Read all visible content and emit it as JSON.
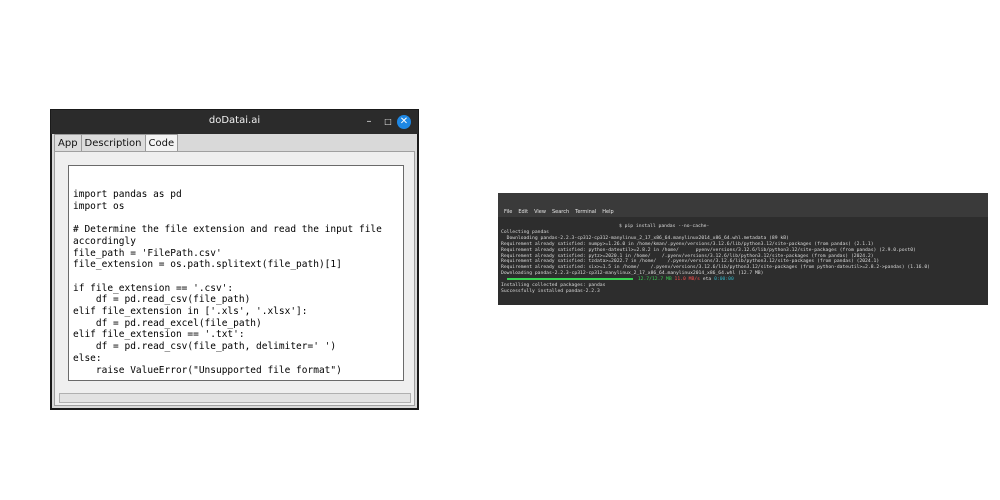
{
  "app_window": {
    "title": "doDatai.ai",
    "controls": {
      "minimize": "–",
      "maximize": "□",
      "close": "✕"
    },
    "tabs": [
      {
        "label": "App",
        "active": false
      },
      {
        "label": "Description",
        "active": false
      },
      {
        "label": "Code",
        "active": true
      }
    ],
    "code": "import pandas as pd\nimport os\n\n# Determine the file extension and read the input file\naccordingly\nfile_path = 'FilePath.csv'\nfile_extension = os.path.splitext(file_path)[1]\n\nif file_extension == '.csv':\n    df = pd.read_csv(file_path)\nelif file_extension in ['.xls', '.xlsx']:\n    df = pd.read_excel(file_path)\nelif file_extension == '.txt':\n    df = pd.read_csv(file_path, delimiter=' ')\nelse:\n    raise ValueError(\"Unsupported file format\")"
  },
  "terminal": {
    "menu": [
      "File",
      "Edit",
      "View",
      "Search",
      "Terminal",
      "Help"
    ],
    "command": "$ pip install pandas --no-cache-",
    "lines_before": [
      "Collecting pandas",
      "  Downloading pandas-2.2.3-cp312-cp312-manylinux_2_17_x86_64.manylinux2014_x86_64.whl.metadata (89 kB)",
      "Requirement already satisfied: numpy>=1.26.0 in /home/kman/.pyenv/versions/3.12.6/lib/python3.12/site-packages (from pandas) (2.1.1)",
      "Requirement already satisfied: python-dateutil>=2.8.2 in /home/      pyenv/versions/3.12.6/lib/python3.12/site-packages (from pandas) (2.9.0.post0)",
      "Requirement already satisfied: pytz>=2020.1 in /home/    /.pyenv/versions/3.12.6/lib/python3.12/site-packages (from pandas) (2024.2)",
      "Requirement already satisfied: tzdata>=2022.7 in /home/    /.pyenv/versions/3.12.6/lib/python3.12/site-packages (from pandas) (2024.1)",
      "Requirement already satisfied: six>=1.5 in /home/    /.pyenv/versions/3.12.6/lib/python3.12/site-packages (from python-dateutil>=2.8.2->pandas) (1.16.0)",
      "Downloading pandas-2.2.3-cp312-cp312-manylinux_2_17_x86_64.manylinux2014_x86_64.whl (12.7 MB)"
    ],
    "progress": {
      "size": "12.7/12.7 MB",
      "speed": "11.0 MB/s",
      "eta_label": "eta",
      "eta": "0:00:00"
    },
    "lines_after": [
      "Installing collected packages: pandas",
      "Successfully installed pandas-2.2.3"
    ]
  }
}
